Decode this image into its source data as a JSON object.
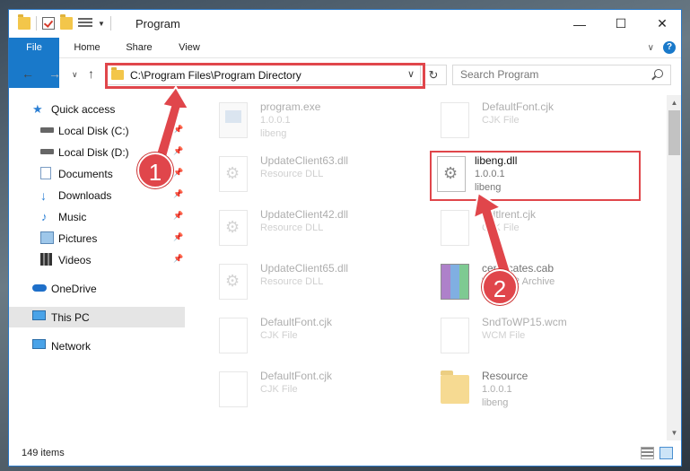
{
  "window": {
    "title": "Program",
    "minimize": "—",
    "maximize": "☐",
    "close": "✕"
  },
  "ribbon": {
    "tabs": [
      "File",
      "Home",
      "Share",
      "View"
    ],
    "collapse": "∨",
    "help": "?"
  },
  "nav": {
    "back": "←",
    "forward": "→",
    "recent": "∨",
    "up": "↑"
  },
  "address": {
    "path": "C:\\Program Files\\Program Directory",
    "chevron": "∨",
    "refresh": "↻"
  },
  "search": {
    "placeholder": "Search Program"
  },
  "sidebar": {
    "items": [
      {
        "label": "Quick access",
        "icon": "star-icon",
        "pinned": false
      },
      {
        "label": "Local Disk (C:)",
        "icon": "drive-icon",
        "pinned": true
      },
      {
        "label": "Local Disk (D:)",
        "icon": "drive-icon",
        "pinned": true
      },
      {
        "label": "Documents",
        "icon": "documents-icon",
        "pinned": true
      },
      {
        "label": "Downloads",
        "icon": "download-icon",
        "pinned": true
      },
      {
        "label": "Music",
        "icon": "music-icon",
        "pinned": true
      },
      {
        "label": "Pictures",
        "icon": "pictures-icon",
        "pinned": true
      },
      {
        "label": "Videos",
        "icon": "videos-icon",
        "pinned": true
      },
      {
        "label": "OneDrive",
        "icon": "cloud-icon",
        "pinned": false
      },
      {
        "label": "This PC",
        "icon": "computer-icon",
        "pinned": false,
        "selected": true
      },
      {
        "label": "Network",
        "icon": "network-icon",
        "pinned": false
      }
    ],
    "pin_glyph": "📌"
  },
  "files": [
    {
      "name": "program.exe",
      "line2": "1.0.0.1",
      "line3": "libeng",
      "icon": "exe-icon"
    },
    {
      "name": "DefaultFont.cjk",
      "line2": "CJK File",
      "line3": "",
      "icon": "document-icon"
    },
    {
      "name": "UpdateClient63.dll",
      "line2": "Resource DLL",
      "line3": "",
      "icon": "dll-icon"
    },
    {
      "name": "libeng.dll",
      "line2": "1.0.0.1",
      "line3": "libeng",
      "icon": "dll-icon",
      "highlighted": true
    },
    {
      "name": "UpdateClient42.dll",
      "line2": "Resource DLL",
      "line3": "",
      "icon": "dll-icon"
    },
    {
      "name": "Ddtlrent.cjk",
      "line2": "CJK File",
      "line3": "",
      "icon": "document-icon"
    },
    {
      "name": "UpdateClient65.dll",
      "line2": "Resource DLL",
      "line3": "",
      "icon": "dll-icon"
    },
    {
      "name": "certificates.cab",
      "line2": "WinRAR Archive",
      "line3": "",
      "icon": "archive-icon"
    },
    {
      "name": "DefaultFont.cjk",
      "line2": "CJK File",
      "line3": "",
      "icon": "document-icon"
    },
    {
      "name": "SndToWP15.wcm",
      "line2": "WCM File",
      "line3": "",
      "icon": "document-icon"
    },
    {
      "name": "DefaultFont.cjk",
      "line2": "CJK File",
      "line3": "",
      "icon": "document-icon"
    },
    {
      "name": "Resource",
      "line2": "1.0.0.1",
      "line3": "libeng",
      "icon": "folder-icon"
    }
  ],
  "status": {
    "count": "149 items"
  },
  "annotations": {
    "step1": "1",
    "step2": "2",
    "color": "#e0464b"
  }
}
